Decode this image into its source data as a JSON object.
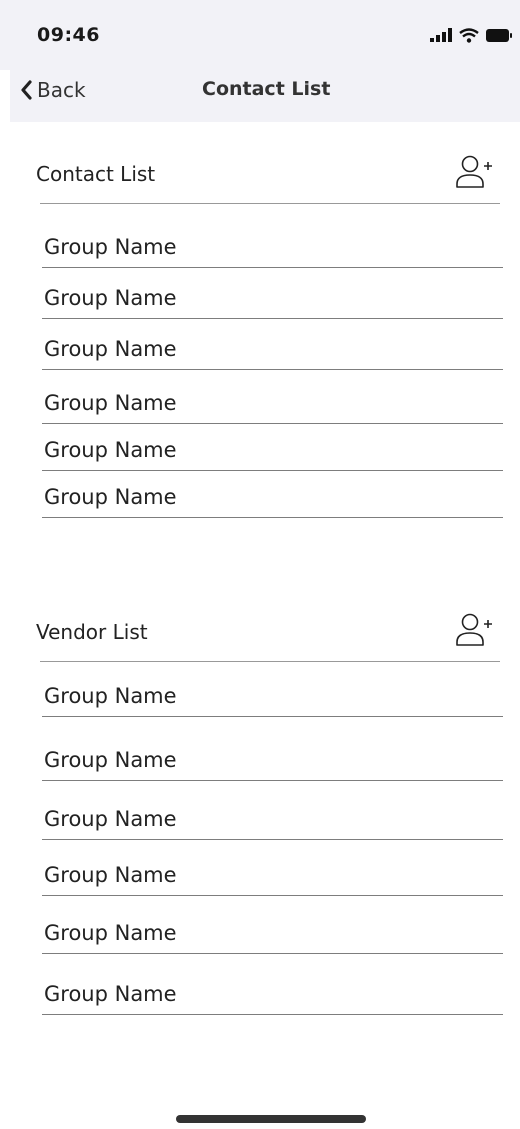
{
  "status": {
    "time": "09:46"
  },
  "nav": {
    "back_label": "Back",
    "title": "Contact List"
  },
  "contact_section": {
    "title": "Contact List",
    "add_icon": "add-user-icon",
    "rows": [
      "Group Name",
      "Group Name",
      "Group Name",
      "Group Name",
      "Group Name",
      "Group Name"
    ]
  },
  "vendor_section": {
    "title": "Vendor List",
    "add_icon": "add-user-icon",
    "rows": [
      "Group Name",
      "Group Name",
      "Group Name",
      "Group Name",
      "Group Name",
      "Group Name"
    ]
  }
}
